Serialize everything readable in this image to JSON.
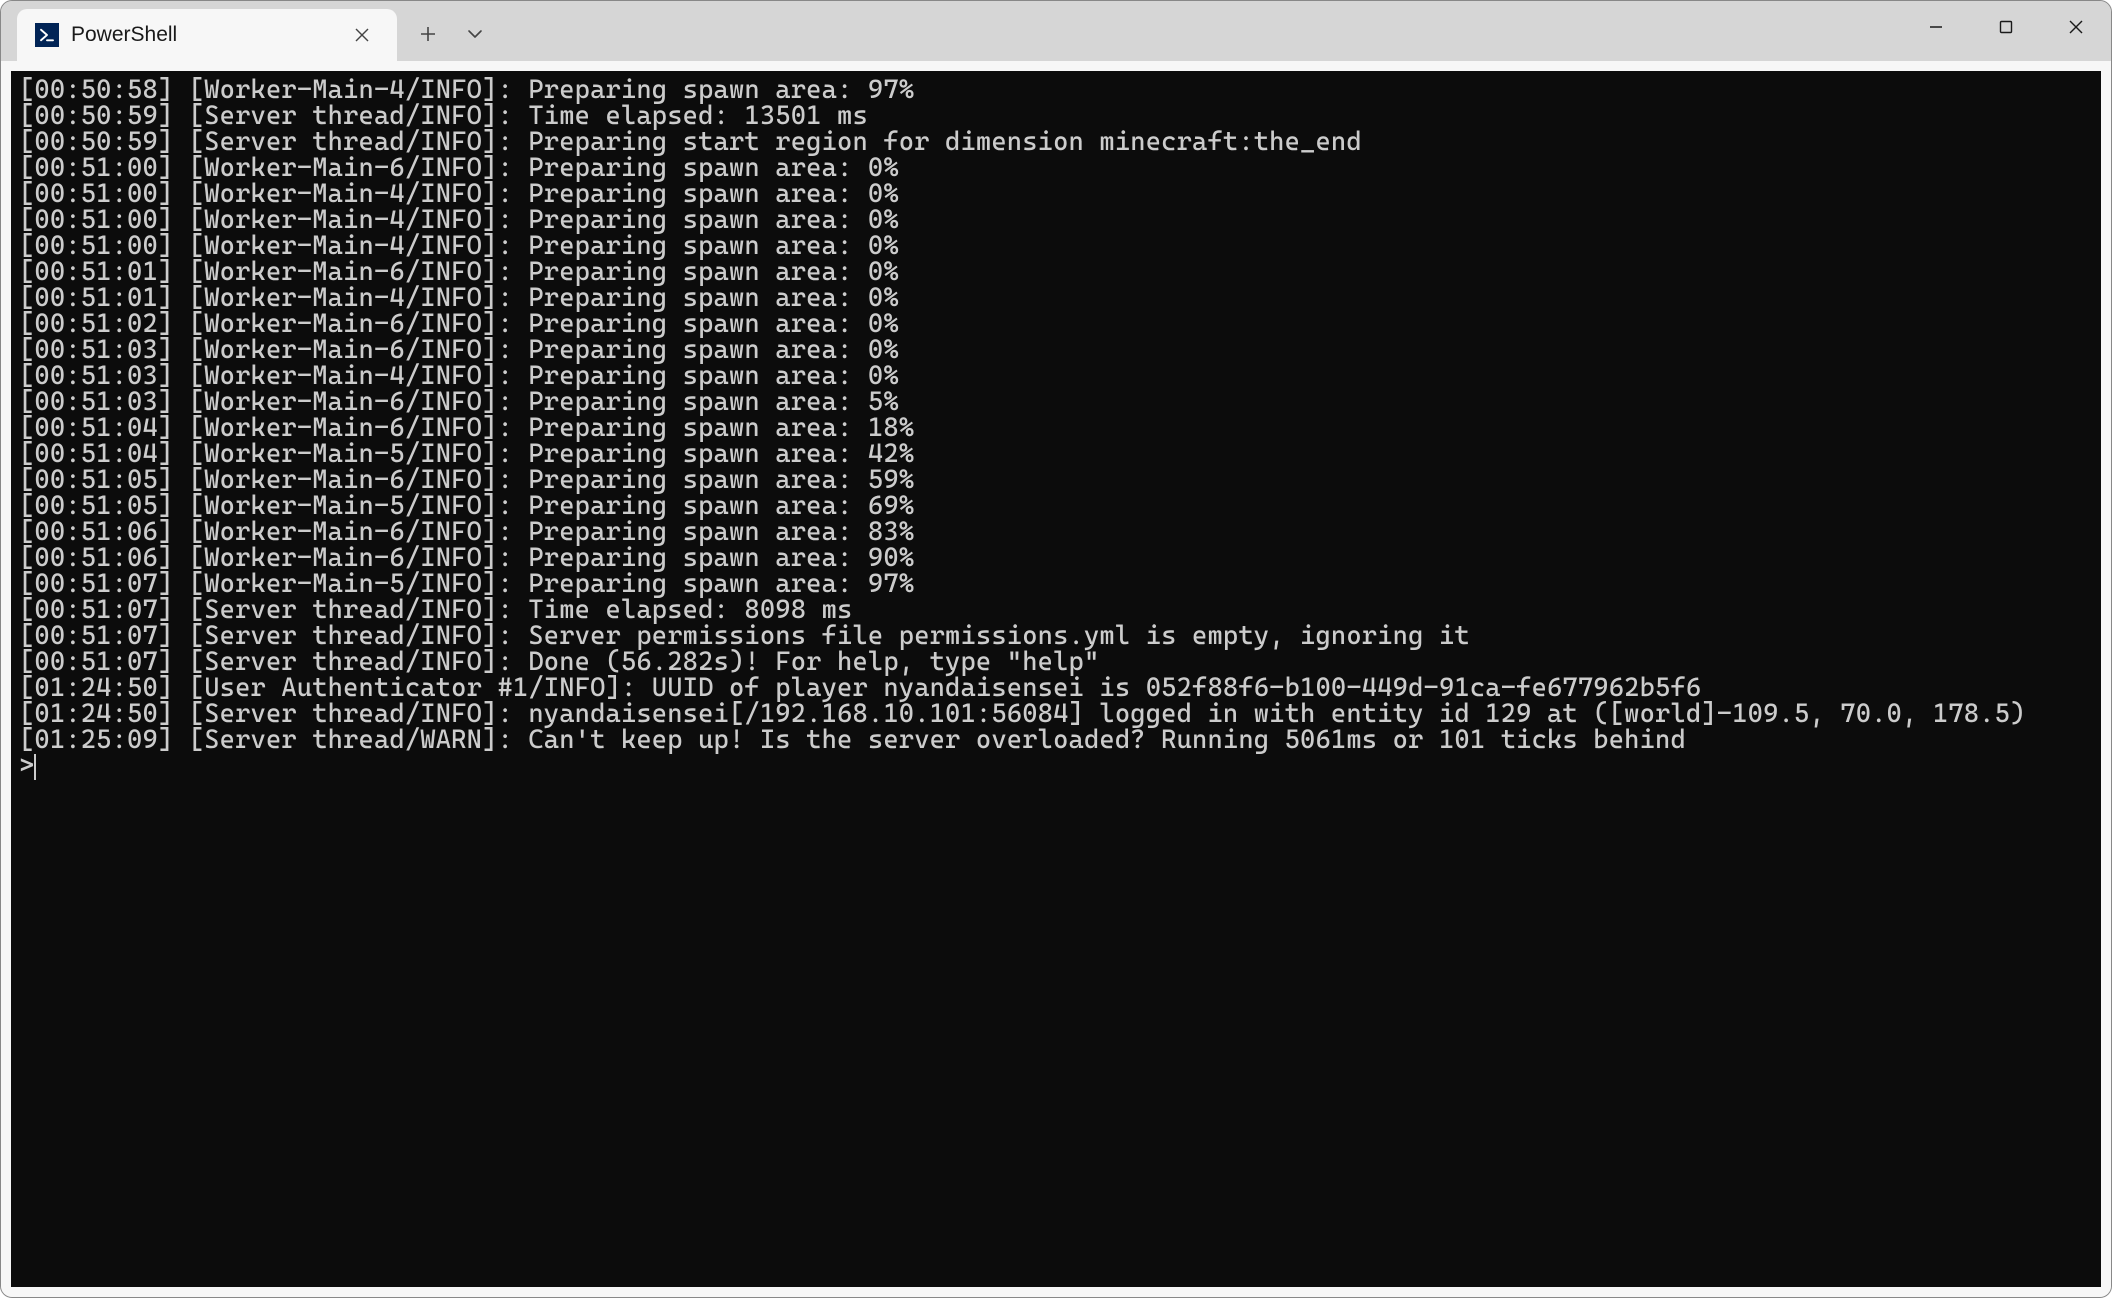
{
  "window": {
    "tab_title": "PowerShell",
    "prompt_symbol": ">"
  },
  "colors": {
    "terminal_bg": "#0c0c0c",
    "terminal_fg": "#cccccc",
    "titlebar_bg": "#d6d6d6",
    "tab_bg": "#f7f7f7",
    "ps_icon_bg": "#012456"
  },
  "log_lines": [
    "[00:50:58] [Worker-Main-4/INFO]: Preparing spawn area: 97%",
    "[00:50:59] [Server thread/INFO]: Time elapsed: 13501 ms",
    "[00:50:59] [Server thread/INFO]: Preparing start region for dimension minecraft:the_end",
    "[00:51:00] [Worker-Main-6/INFO]: Preparing spawn area: 0%",
    "[00:51:00] [Worker-Main-4/INFO]: Preparing spawn area: 0%",
    "[00:51:00] [Worker-Main-4/INFO]: Preparing spawn area: 0%",
    "[00:51:00] [Worker-Main-4/INFO]: Preparing spawn area: 0%",
    "[00:51:01] [Worker-Main-6/INFO]: Preparing spawn area: 0%",
    "[00:51:01] [Worker-Main-4/INFO]: Preparing spawn area: 0%",
    "[00:51:02] [Worker-Main-6/INFO]: Preparing spawn area: 0%",
    "[00:51:03] [Worker-Main-6/INFO]: Preparing spawn area: 0%",
    "[00:51:03] [Worker-Main-4/INFO]: Preparing spawn area: 0%",
    "[00:51:03] [Worker-Main-6/INFO]: Preparing spawn area: 5%",
    "[00:51:04] [Worker-Main-6/INFO]: Preparing spawn area: 18%",
    "[00:51:04] [Worker-Main-5/INFO]: Preparing spawn area: 42%",
    "[00:51:05] [Worker-Main-6/INFO]: Preparing spawn area: 59%",
    "[00:51:05] [Worker-Main-5/INFO]: Preparing spawn area: 69%",
    "[00:51:06] [Worker-Main-6/INFO]: Preparing spawn area: 83%",
    "[00:51:06] [Worker-Main-6/INFO]: Preparing spawn area: 90%",
    "[00:51:07] [Worker-Main-5/INFO]: Preparing spawn area: 97%",
    "[00:51:07] [Server thread/INFO]: Time elapsed: 8098 ms",
    "[00:51:07] [Server thread/INFO]: Server permissions file permissions.yml is empty, ignoring it",
    "[00:51:07] [Server thread/INFO]: Done (56.282s)! For help, type \"help\"",
    "[01:24:50] [User Authenticator #1/INFO]: UUID of player nyandaisensei is 052f88f6-b100-449d-91ca-fe677962b5f6",
    "[01:24:50] [Server thread/INFO]: nyandaisensei[/192.168.10.101:56084] logged in with entity id 129 at ([world]-109.5, 70.0, 178.5)",
    "[01:25:09] [Server thread/WARN]: Can't keep up! Is the server overloaded? Running 5061ms or 101 ticks behind"
  ]
}
